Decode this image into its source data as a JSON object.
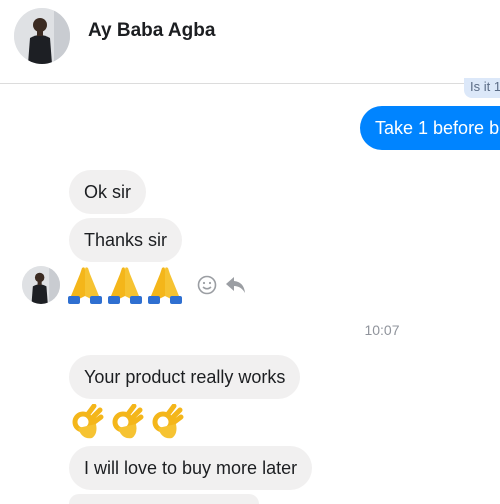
{
  "contact": {
    "name": "Ay Baba Agba"
  },
  "messages": {
    "partial_top": "Is it 1",
    "outgoing_1": "Take 1 before b",
    "incoming_1": "Ok sir",
    "incoming_2": "Thanks sir",
    "timestamp": "10:07",
    "incoming_3": "Your product really works",
    "incoming_4": "I will love to buy more later"
  },
  "emojis": {
    "prayer_row": [
      "folded-hands",
      "folded-hands",
      "folded-hands"
    ],
    "ok_row": [
      "ok-hand",
      "ok-hand",
      "ok-hand"
    ]
  },
  "colors": {
    "outgoing_bubble": "#0084ff",
    "incoming_bubble": "#f1f0f0",
    "timestamp": "#90949c"
  }
}
